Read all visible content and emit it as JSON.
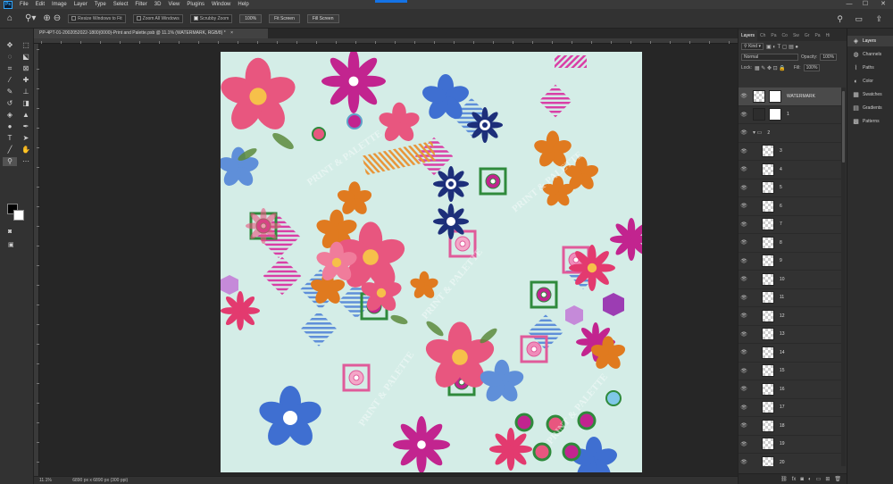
{
  "app": {
    "logo_text": "Ps",
    "menu": [
      "File",
      "Edit",
      "Image",
      "Layer",
      "Type",
      "Select",
      "Filter",
      "3D",
      "View",
      "Plugins",
      "Window",
      "Help"
    ],
    "window_controls": {
      "minimize": "—",
      "maximize": "☐",
      "close": "✕"
    }
  },
  "options_bar": {
    "home_icon": "home-icon",
    "zoom_tool_icon": "zoom-icon",
    "resize_windows": "Resize Windows to Fit",
    "zoom_all": "Zoom All Windows",
    "scrubby_zoom": "Scrubby Zoom",
    "zoom_value": "100%",
    "fit_screen": "Fit Screen",
    "fill_screen": "Fill Screen",
    "search_icon": "search-icon",
    "workspace_icon": "workspace-icon",
    "share_icon": "share-icon"
  },
  "document": {
    "tab_title": "PP-4PT-01-2002052022-1800(0000)-Print and Palette.psb @ 11.1% (WATERMARK, RGB/8) *",
    "tab_close": "×"
  },
  "status_bar": {
    "zoom": "11.1%",
    "doc_info": "6890 px x 6890 px (300 ppi)"
  },
  "layers_panel": {
    "tabs": [
      "Layers",
      "Ch",
      "Pa",
      "Co",
      "Sw",
      "Gr",
      "Pa",
      "Hi"
    ],
    "filter_kind": "Kind",
    "blend_mode": "Normal",
    "opacity_label": "Opacity:",
    "opacity_value": "100%",
    "lock_label": "Lock:",
    "fill_label": "Fill:",
    "fill_value": "100%",
    "layers": [
      {
        "name": "WATERMARK",
        "selected": true,
        "type": "smart"
      },
      {
        "name": "1",
        "selected": false,
        "type": "adjustment"
      },
      {
        "name": "2",
        "selected": false,
        "type": "group"
      },
      {
        "name": "3",
        "selected": false,
        "type": "pixel"
      },
      {
        "name": "4",
        "selected": false,
        "type": "pixel"
      },
      {
        "name": "5",
        "selected": false,
        "type": "pixel"
      },
      {
        "name": "6",
        "selected": false,
        "type": "pixel"
      },
      {
        "name": "7",
        "selected": false,
        "type": "pixel"
      },
      {
        "name": "8",
        "selected": false,
        "type": "pixel"
      },
      {
        "name": "9",
        "selected": false,
        "type": "pixel"
      },
      {
        "name": "10",
        "selected": false,
        "type": "pixel"
      },
      {
        "name": "11",
        "selected": false,
        "type": "pixel"
      },
      {
        "name": "12",
        "selected": false,
        "type": "pixel"
      },
      {
        "name": "13",
        "selected": false,
        "type": "pixel"
      },
      {
        "name": "14",
        "selected": false,
        "type": "pixel"
      },
      {
        "name": "15",
        "selected": false,
        "type": "pixel"
      },
      {
        "name": "16",
        "selected": false,
        "type": "pixel"
      },
      {
        "name": "17",
        "selected": false,
        "type": "pixel"
      },
      {
        "name": "18",
        "selected": false,
        "type": "pixel"
      },
      {
        "name": "19",
        "selected": false,
        "type": "pixel"
      },
      {
        "name": "20",
        "selected": false,
        "type": "pixel"
      }
    ]
  },
  "dock": {
    "items": [
      "Layers",
      "Channels",
      "Paths",
      "Color",
      "Swatches",
      "Gradients",
      "Patterns"
    ]
  },
  "artwork": {
    "watermark_text": "PRINT & PALETTE",
    "colors": {
      "background": "#c9e8e2",
      "pink": "#e8567f",
      "magenta": "#c2248f",
      "navy": "#1d2f7a",
      "orange": "#e07a1f",
      "green": "#2f8a3c",
      "blue": "#3f6fd1",
      "lilac": "#c58ad9"
    }
  }
}
